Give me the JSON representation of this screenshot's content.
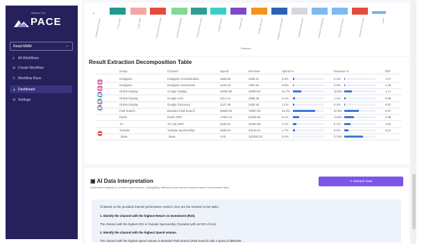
{
  "sidebar": {
    "logo_small": "Where For",
    "logo_name": "PACE",
    "select_value": "Retail MMM",
    "items": [
      {
        "label": "All Workflows",
        "icon": "list-icon"
      },
      {
        "label": "Create Workflow",
        "icon": "plus-circle-icon"
      },
      {
        "label": "Workflow Runs",
        "icon": "refresh-icon"
      },
      {
        "label": "Dashboard",
        "icon": "person-icon",
        "active": true
      },
      {
        "label": "Settings",
        "icon": "gear-icon"
      }
    ]
  },
  "chart": {
    "colors": [
      "#1d9b8d",
      "#f7a5a2",
      "#e34b3b",
      "#83d893",
      "#2f9d91",
      "#3ad0c7",
      "#7b4acb",
      "#f7921e",
      "#2d61b6",
      "#d5d7dc",
      "#7bb9f0",
      "#7dbaf1",
      "#e34b3b",
      "#77b4f0"
    ],
    "labels": [
      "Google Brand Search",
      "TV Ads GRP",
      "Radio GRP",
      "Facebook Prospecting",
      "Facebook Retargeting",
      "Facebook Awareness",
      "Google Display",
      "Google UAC",
      "Google Discovery",
      "Instagram Consideration",
      "Instagram Awareness",
      "Instagram Retargeting",
      "Branded Paid Search",
      "Youtube Sponsorship",
      "_Base"
    ],
    "axis_title": "Features"
  },
  "table": {
    "title": "Result Extraction Decomposition Table",
    "headers": [
      "Group",
      "Channel",
      "Spend",
      "Revenue",
      "Spend %",
      "Revenue %",
      "ROI"
    ],
    "rows": [
      {
        "icon": "instagram",
        "group": "Instagram",
        "channel": "Instagram Consideration",
        "spend": "1665.56",
        "revenue": "2085.21",
        "spend_pct": "0.8%",
        "revenue_pct": "0.4%",
        "roi": "1.27",
        "spend_bar": 0.04,
        "revenue_bar": 0.02
      },
      {
        "icon": "instagram",
        "group": "Instagram",
        "channel": "Instagram Awareness",
        "spend": "1245.25",
        "revenue": "1597.84",
        "spend_pct": "0.6%",
        "revenue_pct": "0.3%",
        "roi": "1.28",
        "spend_bar": 0.03,
        "revenue_bar": 0.015
      },
      {
        "icon": "google",
        "group": "Online Display",
        "channel": "Google Display",
        "spend": "34000.90",
        "revenue": "40090.94",
        "spend_pct": "11.7%",
        "revenue_pct": "10.6%",
        "roi": "1.17",
        "spend_bar": 0.27,
        "revenue_bar": 0.24
      },
      {
        "icon": "google",
        "group": "Online Display",
        "channel": "Google UAC",
        "spend": "4114.13",
        "revenue": "4086.38",
        "spend_pct": "2.1%",
        "revenue_pct": "1.1%",
        "roi": "0.99",
        "spend_bar": 0.07,
        "revenue_bar": 0.04
      },
      {
        "icon": "google",
        "group": "Online Display",
        "channel": "Google Discovery",
        "spend": "2127.38",
        "revenue": "2066.30",
        "spend_pct": "1.1%",
        "revenue_pct": "0.4%",
        "roi": "0.97",
        "spend_bar": 0.05,
        "revenue_bar": 0.02
      },
      {
        "icon": "",
        "group": "Paid Search",
        "channel": "Branded Paid Search",
        "spend": "89850.04",
        "revenue": "78087.92",
        "spend_pct": "46.3%",
        "revenue_pct": "20.8%",
        "roi": "0.87",
        "spend_bar": 0.72,
        "revenue_bar": 0.46
      },
      {
        "icon": "",
        "group": "Radio",
        "channel": "Radio GRP",
        "spend": "17604.13",
        "revenue": "52292.60",
        "spend_pct": "9.1%",
        "revenue_pct": "13.9%",
        "roi": "2.98",
        "spend_bar": 0.19,
        "revenue_bar": 0.31
      },
      {
        "icon": "",
        "group": "TV",
        "channel": "TV Ads GRP",
        "spend": "9168.02",
        "revenue": "32250.35",
        "spend_pct": "4.7%",
        "revenue_pct": "8.7%",
        "roi": "3.52",
        "spend_bar": 0.1,
        "revenue_bar": 0.19
      },
      {
        "icon": "youtube",
        "group": "Youtube",
        "channel": "Youtube Sponsorship",
        "spend": "3458.02",
        "revenue": "22146.21",
        "spend_pct": "1.7%",
        "revenue_pct": "5.9%",
        "roi": "6.51",
        "spend_bar": 0.06,
        "revenue_bar": 0.13
      },
      {
        "icon": "",
        "group": "_Base",
        "channel": "_Base",
        "spend": "0.00",
        "revenue": "102393.28",
        "spend_pct": "0.0%",
        "revenue_pct": "27.5%",
        "roi": "",
        "spend_bar": 0.0,
        "revenue_bar": 0.61
      }
    ]
  },
  "ai": {
    "title": "AI Data Interpretation",
    "subtitle": "Automated analysis of channel performance, highlighting efficiency and volume leaders based on presented data.",
    "button": "Interpret Data",
    "intro": "Based on the provided channel performance metrics, here are the answers to the tasks:",
    "q1": "1. Identify the channel with the highest Return on Investment (ROI).",
    "a1": "The channel with the highest ROI is Youtube Sponsorship (Youtube) with an ROI of 6.51",
    "q2": "2. Identify the channel with the highest Spend volume.",
    "a2": "The channel with the highest spend volume is Branded Paid Search (Paid Search) with a spend of $89,850..."
  }
}
